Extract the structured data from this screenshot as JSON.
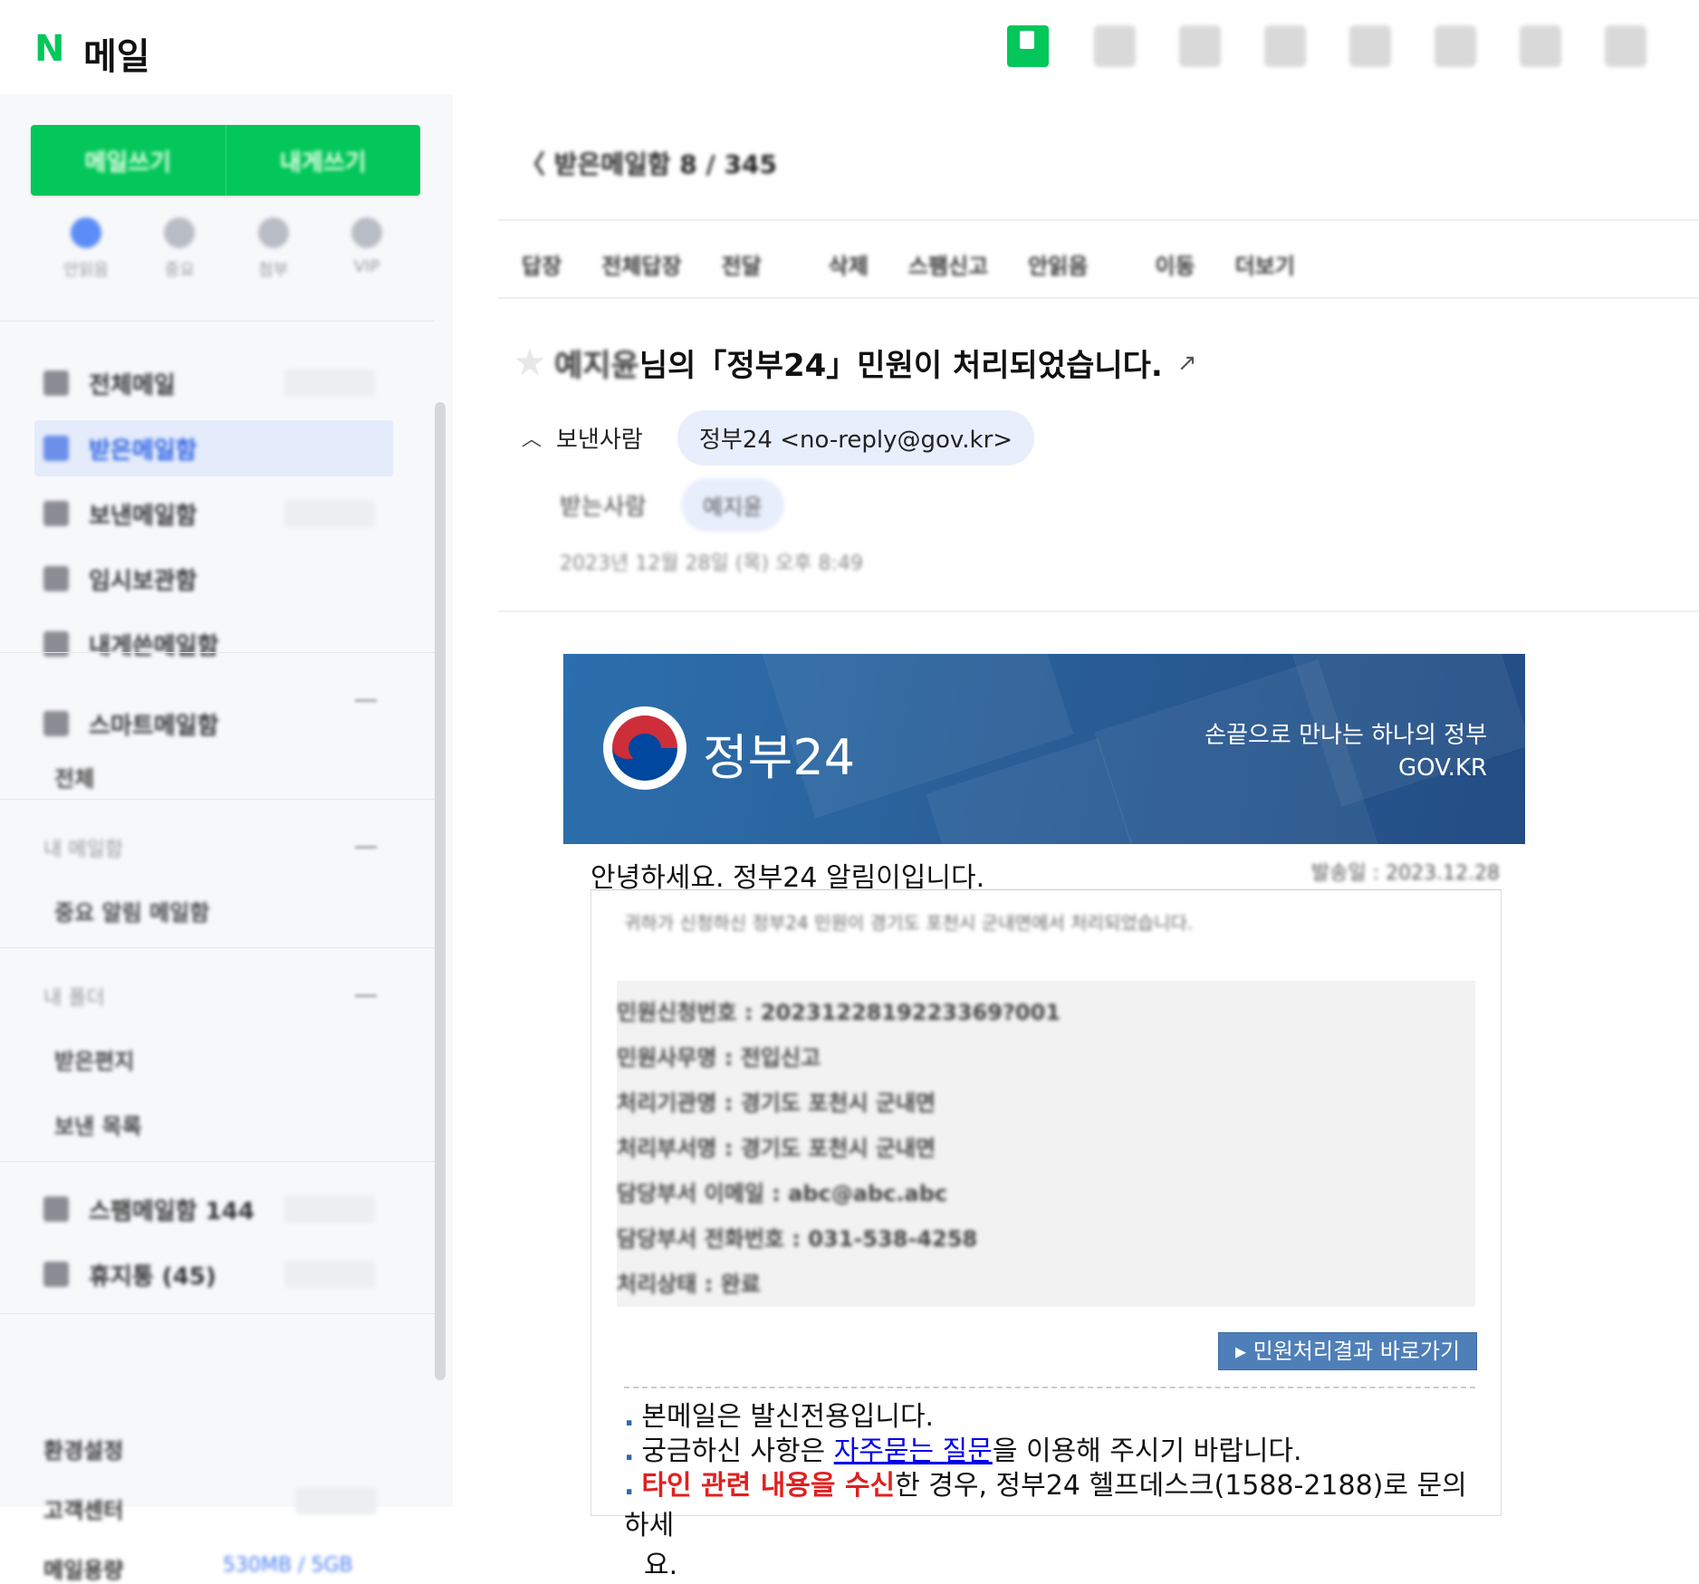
{
  "app": {
    "logo_letter": "N",
    "logo_text": "메일"
  },
  "sidebar": {
    "compose": [
      "메일쓰기",
      "내게쓰기"
    ],
    "quick": [
      "안읽음",
      "중요",
      "첨부",
      "VIP"
    ],
    "items": [
      {
        "label": "전체메일"
      },
      {
        "label": "받은메일함"
      },
      {
        "label": "보낸메일함"
      },
      {
        "label": "임시보관함"
      },
      {
        "label": "내게쓴메일함"
      },
      {
        "label": "스마트메일함"
      }
    ],
    "sub_1": "전체",
    "section_2": "내 메일함",
    "sub_2": "중요 알림 메일함",
    "section_3": "내 폴더",
    "sub_3": "받은편지",
    "sub_4": "보낸 목록",
    "spam": "스팸메일함 144",
    "trash": "휴지통 (45)",
    "bottom_1": "환경설정",
    "bottom_2": "고객센터",
    "bottom_3": "메일용량",
    "storage": "530MB / 5GB"
  },
  "mail": {
    "breadcrumb": "〈 받은메일함 8 / 345",
    "toolbar": [
      "답장",
      "전체답장",
      "전달",
      "삭제",
      "스팸신고",
      "안읽음",
      "이동",
      "더보기"
    ],
    "subject_name": "예지윤",
    "subject_rest": "님의「정부24」민원이 처리되었습니다.",
    "ext_icon": "↗",
    "sender_label": "보낸사람",
    "sender": "정부24 <no-reply@gov.kr>",
    "receiver_label": "받는사람",
    "receiver": "예지윤",
    "date": "2023년 12월 28일 (목) 오후 8:49"
  },
  "email": {
    "brand": "정부24",
    "tagline": "손끝으로 만나는 하나의 정부",
    "site": "GOV.KR",
    "greeting": "안녕하세요. 정부24 알림이입니다.",
    "sent_date": "발송일 : 2023.12.28",
    "intro": "귀하가 신청하신 정부24 민원이 경기도 포천시 군내면에서 처리되었습니다.",
    "details": [
      "민원신청번호 : 2023122819223369?001",
      "민원사무명 : 전입신고",
      "처리기관명 : 경기도 포천시 군내면",
      "처리부서명 : 경기도 포천시 군내면",
      "담당부서 이메일 : abc@abc.abc",
      "담당부서 전화번호 : 031-538-4258",
      "처리상태 : 완료"
    ],
    "result_button": "민원처리결과 바로가기",
    "note_1": "본메일은 발신전용입니다.",
    "note_2_pre": "궁금하신 사항은 ",
    "note_2_link": "자주묻는 질문",
    "note_2_post": "을 이용해 주시기 바랍니다.",
    "note_3_red": "타인 관련 내용을 수신",
    "note_3_post": "한 경우, 정부24 헬프데스크(1588-2188)로 문의하세",
    "note_3_wrap": "요."
  }
}
